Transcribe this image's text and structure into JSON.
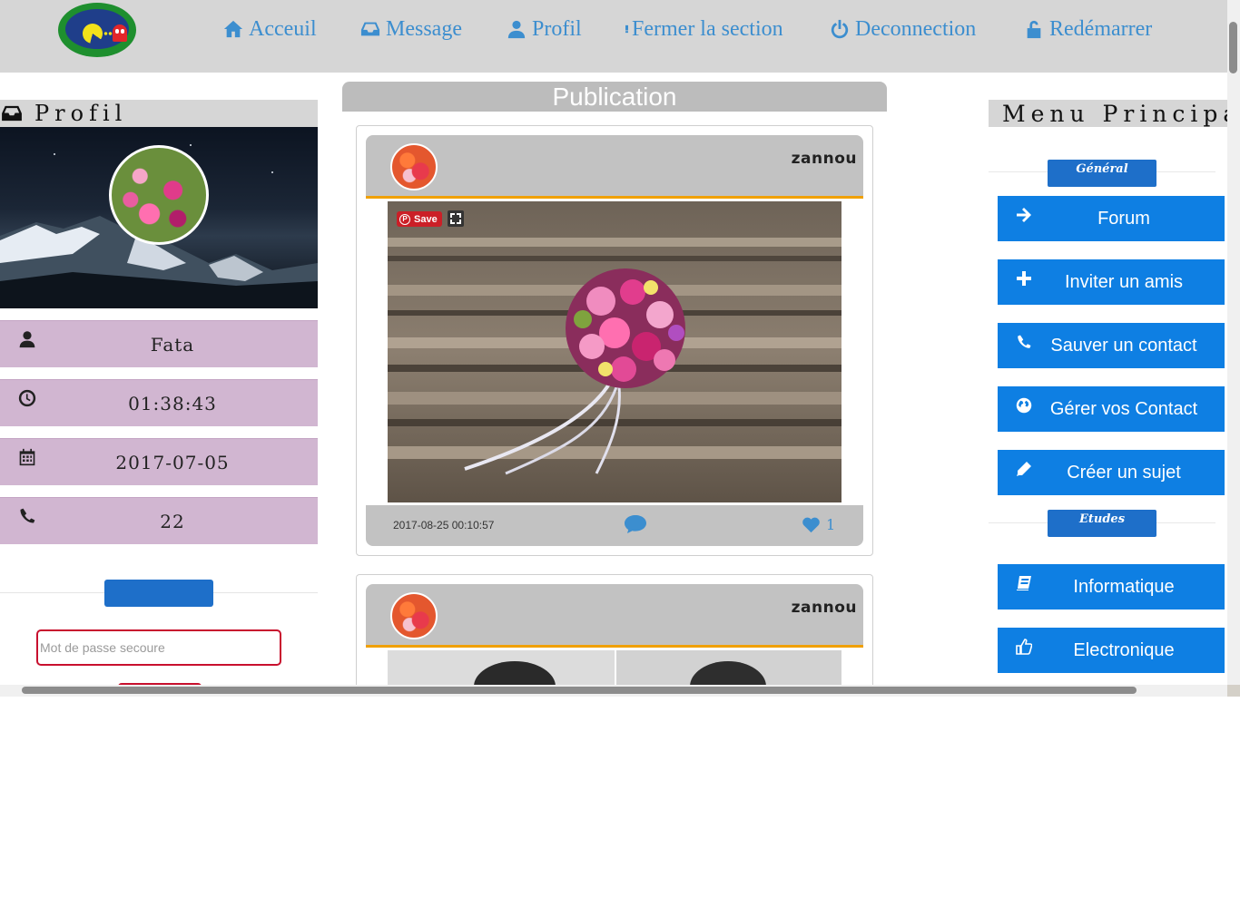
{
  "nav": {
    "items": [
      {
        "label": "Acceuil",
        "icon": "home-icon"
      },
      {
        "label": "Message",
        "icon": "inbox-icon"
      },
      {
        "label": "Profil",
        "icon": "user-icon"
      },
      {
        "label": "Fermer la section",
        "icon": "exclamation-icon"
      },
      {
        "label": "Deconnection",
        "icon": "power-icon"
      },
      {
        "label": "Redémarrer",
        "icon": "unlock-icon"
      }
    ]
  },
  "profile": {
    "heading": "Profil",
    "name": "Fata",
    "time": "01:38:43",
    "date": "2017-07-05",
    "phone": "22",
    "password_placeholder": "Mot de passe secoure"
  },
  "feed": {
    "title": "Publication",
    "posts": [
      {
        "user": "zannou",
        "date": "2017-08-25 00:10:57",
        "likes": "1",
        "save_label": "Save"
      },
      {
        "user": "zannou"
      }
    ]
  },
  "menu": {
    "heading": "Menu Principal",
    "sections": [
      {
        "label": "Général",
        "items": [
          {
            "label": "Forum",
            "icon": "arrow-right-icon"
          },
          {
            "label": "Inviter un amis",
            "icon": "plus-icon"
          },
          {
            "label": "Sauver un contact",
            "icon": "phone-icon"
          },
          {
            "label": "Gérer vos Contact",
            "icon": "globe-icon"
          },
          {
            "label": "Créer un sujet",
            "icon": "pencil-icon"
          }
        ]
      },
      {
        "label": "Etudes",
        "items": [
          {
            "label": "Informatique",
            "icon": "book-icon"
          },
          {
            "label": "Electronique",
            "icon": "hand-pointer-icon"
          }
        ]
      }
    ]
  },
  "colors": {
    "nav_link": "#3c8ecf",
    "menu_button": "#0e7fe3",
    "section_badge": "#1e6fc9",
    "info_row": "#d1b6d1",
    "post_header_border": "#f0a000",
    "password_border": "#c8102e"
  }
}
